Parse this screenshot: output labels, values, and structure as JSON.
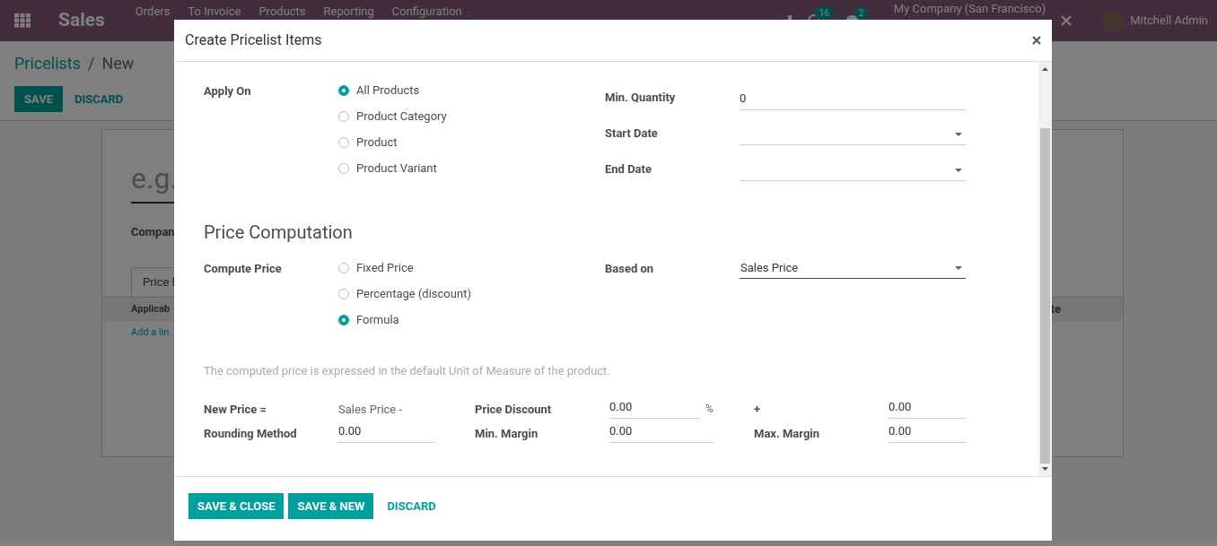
{
  "navbar": {
    "app_name": "Sales",
    "menu": [
      "Orders",
      "To Invoice",
      "Products",
      "Reporting",
      "Configuration"
    ],
    "activity_badge": "16",
    "messages_badge": "2",
    "company": "My Company (San Francisco)",
    "user": "Mitchell Admin"
  },
  "breadcrumb": {
    "parent": "Pricelists",
    "separator": "/",
    "current": "New"
  },
  "actions": [
    {
      "label": "SAVE",
      "kind": "primary"
    },
    {
      "label": "DISCARD",
      "kind": "link"
    }
  ],
  "sheet": {
    "name_placeholder": "e.g.",
    "field_label": "Compan",
    "tab": "Price l",
    "column_1": "Applicab",
    "add_line": "Add a lin",
    "column_2": "te"
  },
  "dialog": {
    "title": "Create Pricelist Items",
    "apply_on": {
      "label": "Apply On",
      "options": [
        {
          "label": "All Products",
          "selected": true
        },
        {
          "label": "Product Category",
          "selected": false
        },
        {
          "label": "Product",
          "selected": false
        },
        {
          "label": "Product Variant",
          "selected": false
        }
      ]
    },
    "quantity_fields": [
      {
        "label": "Min. Quantity",
        "kind": "text",
        "value": "0"
      },
      {
        "label": "Start Date",
        "kind": "date"
      },
      {
        "label": "End Date",
        "kind": "date"
      }
    ],
    "section_title": "Price Computation",
    "compute_price": {
      "label": "Compute Price",
      "options": [
        {
          "label": "Fixed Price",
          "selected": false
        },
        {
          "label": "Percentage (discount)",
          "selected": false
        },
        {
          "label": "Formula",
          "selected": true
        }
      ]
    },
    "based_on": {
      "label": "Based on",
      "value": "Sales Price"
    },
    "note": "The computed price is expressed in the default Unit of Measure of the product.",
    "formula_rows": [
      [
        {
          "kind": "label",
          "text": "New Price ="
        },
        {
          "kind": "text",
          "text": "Sales Price -"
        },
        {
          "kind": "label",
          "text": "Price Discount"
        },
        {
          "kind": "field",
          "value": "0.00",
          "suffix": "%"
        },
        {
          "kind": "label",
          "text": "+"
        },
        {
          "kind": "field",
          "value": "0.00"
        }
      ],
      [
        {
          "kind": "label",
          "text": "Rounding Method"
        },
        {
          "kind": "field",
          "value": "0.00"
        },
        {
          "kind": "label",
          "text": "Min. Margin"
        },
        {
          "kind": "field",
          "value": "0.00"
        },
        {
          "kind": "label",
          "text": "Max. Margin"
        },
        {
          "kind": "field",
          "value": "0.00"
        }
      ]
    ],
    "buttons": [
      {
        "label": "SAVE & CLOSE",
        "kind": "primary"
      },
      {
        "label": "SAVE & NEW",
        "kind": "primary"
      },
      {
        "label": "DISCARD",
        "kind": "link"
      }
    ]
  }
}
